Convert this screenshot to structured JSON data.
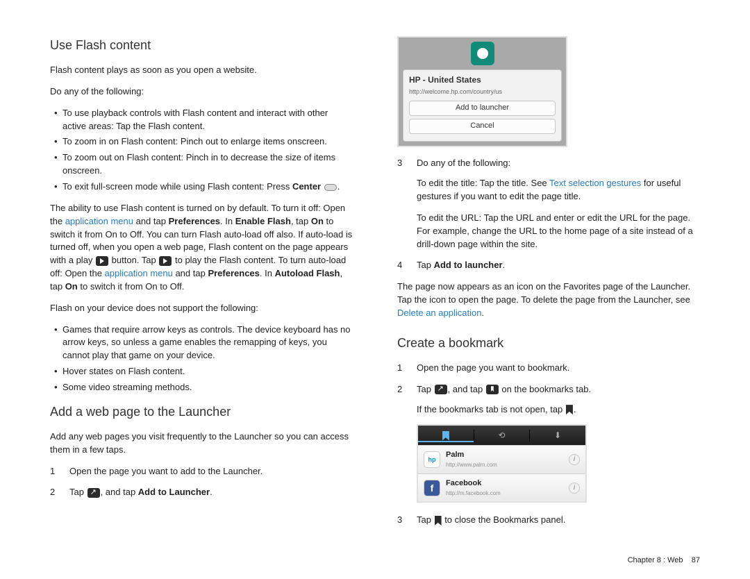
{
  "left": {
    "h_flash": "Use Flash content",
    "p_flash_intro": "Flash content plays as soon as you open a website.",
    "p_do_any": "Do any of the following:",
    "flash_bullets": [
      "To use playback controls with Flash content and interact with other active areas: Tap the Flash content.",
      "To zoom in on Flash content: Pinch out to enlarge items onscreen.",
      "To zoom out on Flash content: Pinch in to decrease the size of items onscreen."
    ],
    "flash_bullet_exit_prefix": "To exit full-screen mode while using Flash content: Press ",
    "flash_bullet_exit_bold": "Center",
    "flash_bullet_exit_suffix": " ",
    "flash_para": {
      "t1": "The ability to use Flash content is turned on by default. To turn it off: Open the ",
      "link1": "application menu",
      "t2": " and tap ",
      "b1": "Preferences",
      "t3": ". In ",
      "b2": "Enable Flash",
      "t4": ", tap ",
      "b3": "On",
      "t5": " to switch it from On to Off. You can turn Flash auto-load off also. If auto-load is turned off, when you open a web page, Flash content on the page appears with a play ",
      "t6": " button. Tap ",
      "t7": " to play the Flash content. To turn auto-load off: Open the ",
      "link2": "application menu",
      "t8": " and tap ",
      "b4": "Preferences",
      "t9": ". In ",
      "b5": "Autoload Flash",
      "t10": ", tap ",
      "b6": "On",
      "t11": " to switch it from On to Off."
    },
    "flash_not_support": "Flash on your device does not support the following:",
    "flash_unsupported": [
      "Games that require arrow keys as controls. The device keyboard has no arrow keys, so unless a game enables the remapping of keys, you cannot play that game on your device.",
      "Hover states on Flash content.",
      "Some video streaming methods."
    ],
    "h_add": "Add a web page to the Launcher",
    "p_add_intro": "Add any web pages you visit frequently to the Launcher so you can access them in a few taps.",
    "add_step1": "Open the page you want to add to the Launcher.",
    "add_step2_a": "Tap ",
    "add_step2_b": ", and tap ",
    "add_step2_bold": "Add to Launcher",
    "add_step2_c": "."
  },
  "right": {
    "dialog": {
      "title": "HP - United States",
      "url": "http://welcome.hp.com/country/us",
      "btn_add": "Add to launcher",
      "btn_cancel": "Cancel"
    },
    "step3_label": "Do any of the following:",
    "step3_edit_title_a": "To edit the title: Tap the title. See ",
    "step3_link": "Text selection gestures",
    "step3_edit_title_b": " for useful gestures if you want to edit the page title.",
    "step3_edit_url": "To edit the URL: Tap the URL and enter or edit the URL for the page. For example, change the URL to the home page of a site instead of a drill-down page within the site.",
    "step4_a": "Tap ",
    "step4_bold": "Add to launcher",
    "step4_b": ".",
    "result_a": "The page now appears as an icon on the Favorites page of the Launcher. Tap the icon to open the page. To delete the page from the Launcher, see ",
    "result_link": "Delete an application",
    "result_b": ".",
    "h_bookmark": "Create a bookmark",
    "bm_step1": "Open the page you want to bookmark.",
    "bm_step2_a": "Tap ",
    "bm_step2_b": ", and tap ",
    "bm_step2_c": " on the bookmarks tab.",
    "bm_note_a": "If the bookmarks tab is not open, tap ",
    "bm_note_b": ".",
    "bm_rows": [
      {
        "title": "Palm",
        "url": "http://www.palm.com"
      },
      {
        "title": "Facebook",
        "url": "http://m.facebook.com"
      }
    ],
    "bm_step3_a": "Tap ",
    "bm_step3_b": " to close the Bookmarks panel."
  },
  "footer": {
    "chapter": "Chapter 8 : Web",
    "page": "87"
  }
}
